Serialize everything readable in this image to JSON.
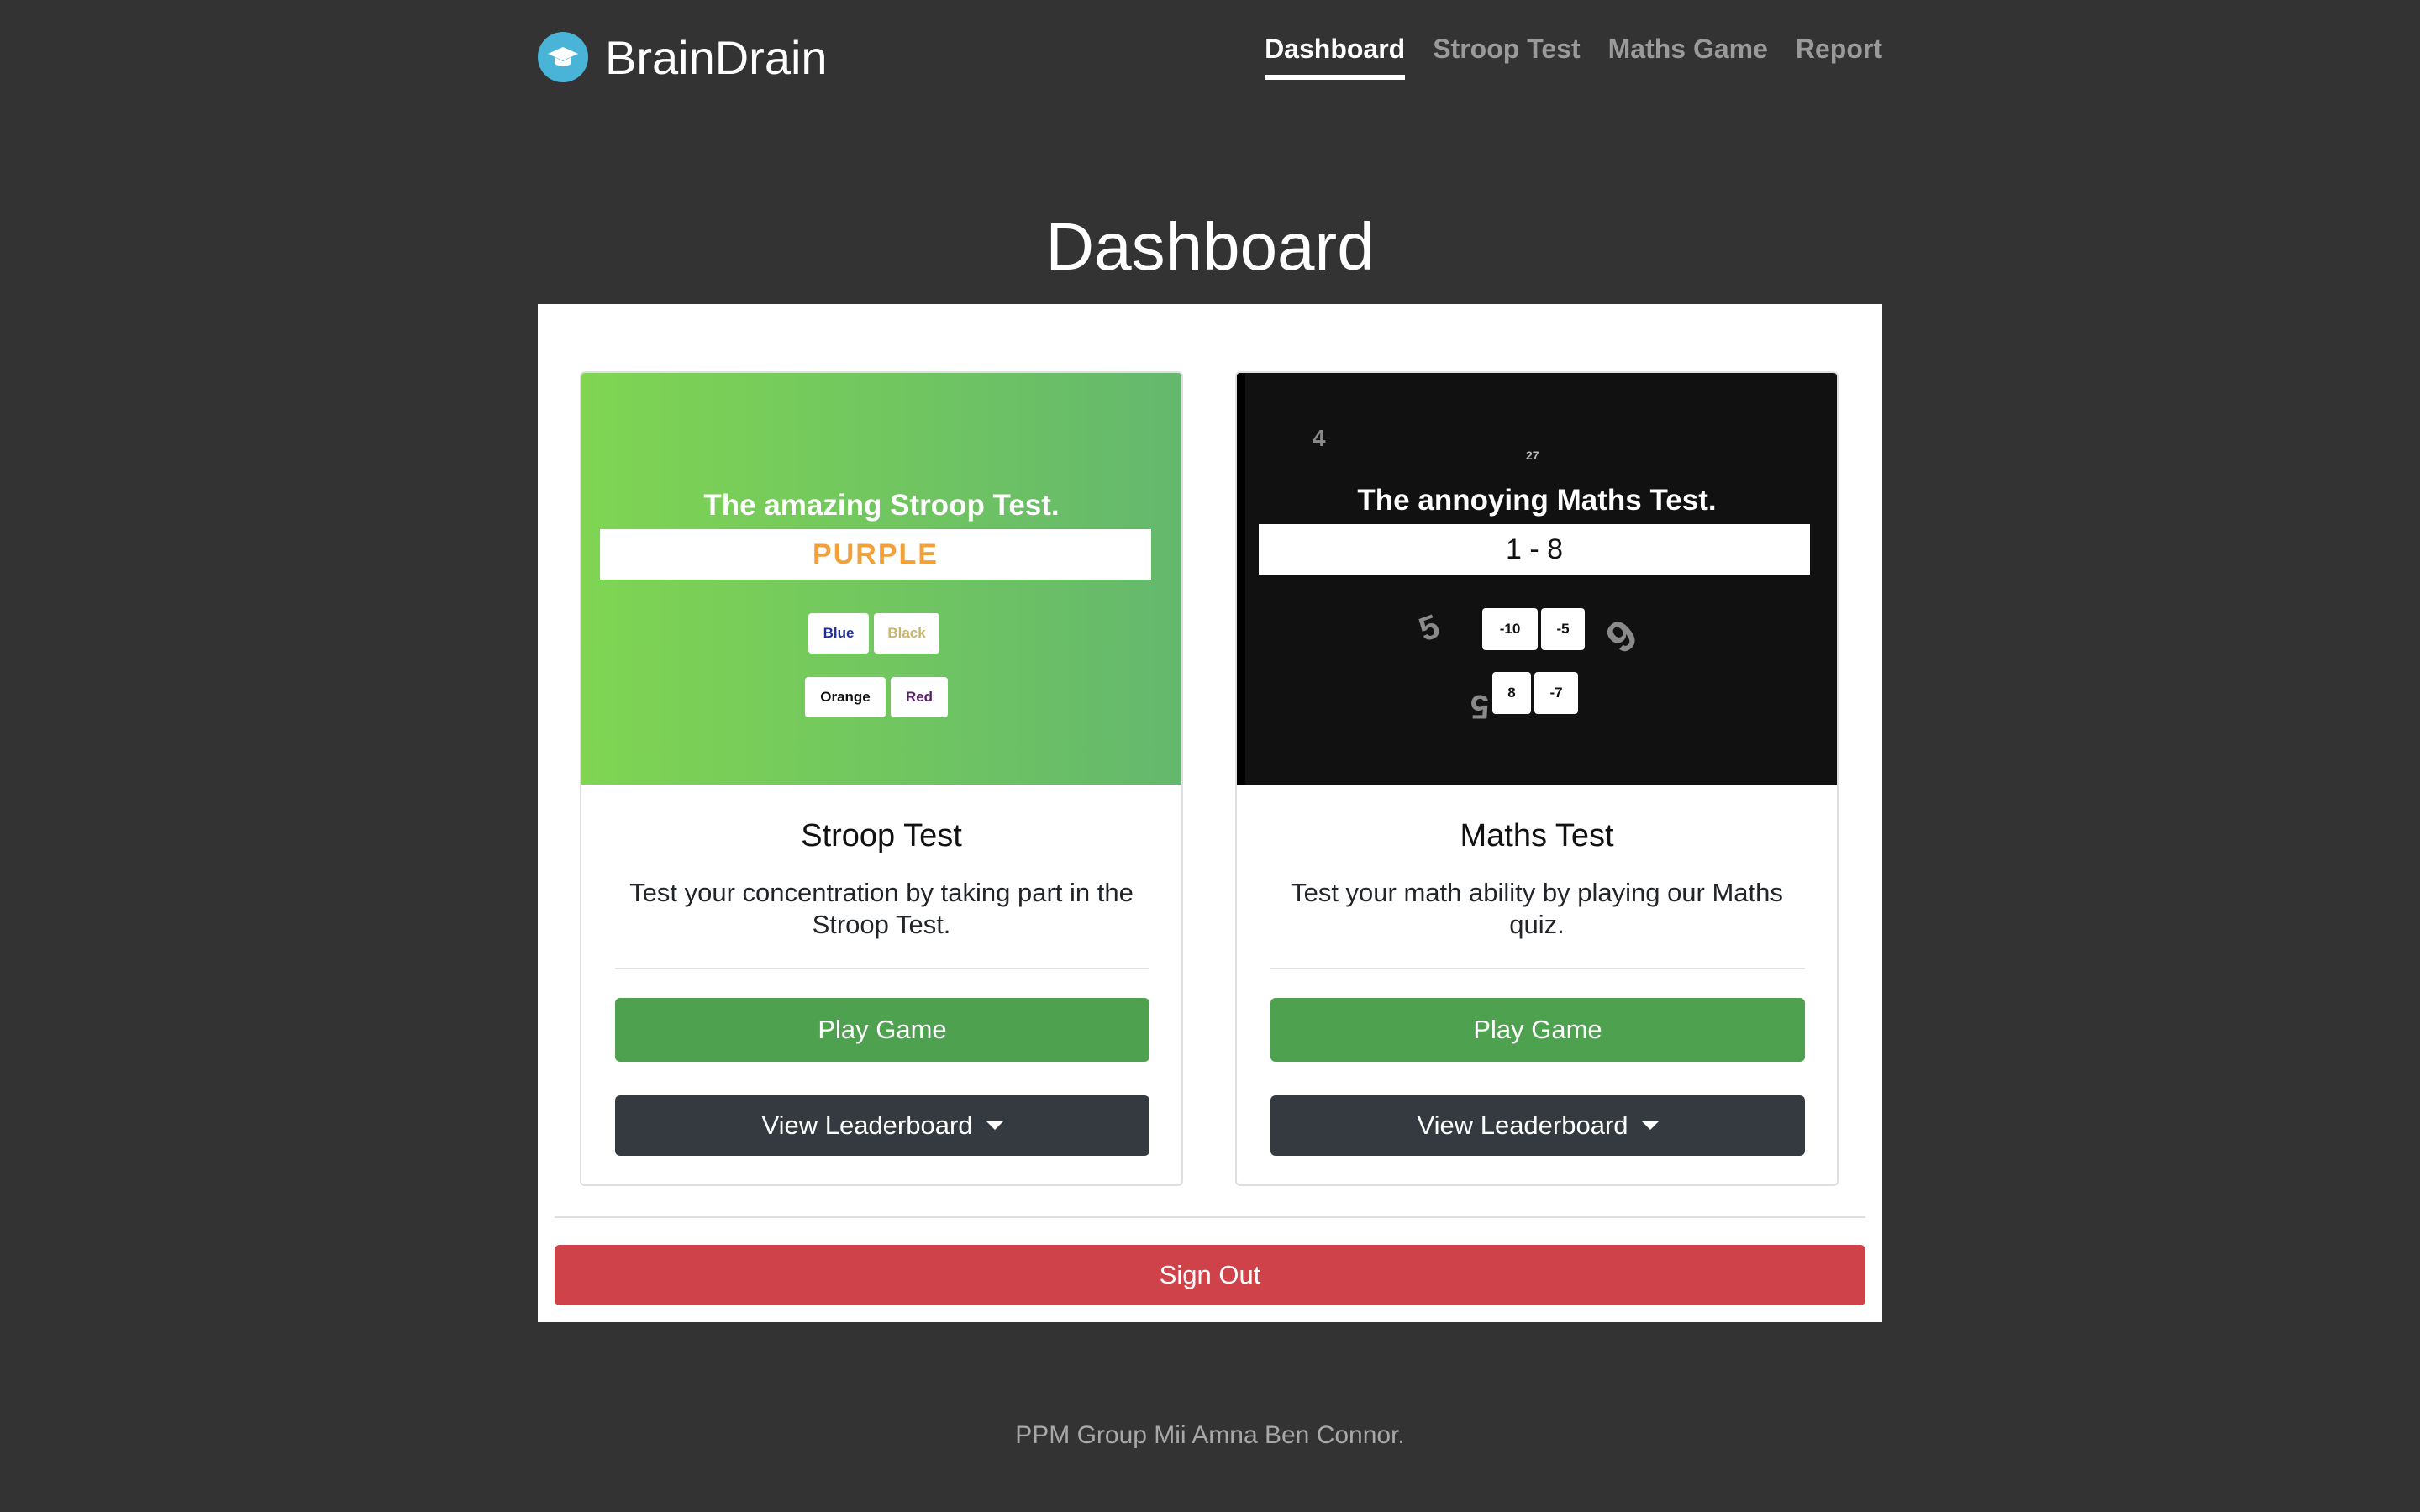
{
  "header": {
    "brand": "BrainDrain",
    "logo_icon": "graduation-cap-icon",
    "nav": [
      {
        "label": "Dashboard",
        "active": true
      },
      {
        "label": "Stroop Test",
        "active": false
      },
      {
        "label": "Maths Game",
        "active": false
      },
      {
        "label": "Report",
        "active": false
      }
    ]
  },
  "page": {
    "title": "Dashboard"
  },
  "cards": {
    "stroop": {
      "preview": {
        "title": "The amazing Stroop Test.",
        "word": "PURPLE",
        "word_color": "#f2a13a",
        "options": [
          "Blue",
          "Black",
          "Orange",
          "Red"
        ]
      },
      "title": "Stroop Test",
      "description": "Test your concentration by taking part in the Stroop Test.",
      "play_label": "Play Game",
      "leaderboard_label": "View Leaderboard"
    },
    "maths": {
      "preview": {
        "title": "The annoying Maths Test.",
        "question": "1 - 8",
        "options": [
          "-10",
          "-5",
          "8",
          "-7"
        ],
        "floating_numbers": [
          "4",
          "27",
          "5",
          "9",
          "5"
        ]
      },
      "title": "Maths Test",
      "description": "Test your math ability by playing our Maths quiz.",
      "play_label": "Play Game",
      "leaderboard_label": "View Leaderboard"
    }
  },
  "signout_label": "Sign Out",
  "footer": "PPM Group Mii Amna Ben Connor.",
  "colors": {
    "background": "#333333",
    "play_button": "#4ea14f",
    "leaderboard_button": "#343a40",
    "signout_button": "#cf4249",
    "logo": "#4ab3d8"
  }
}
